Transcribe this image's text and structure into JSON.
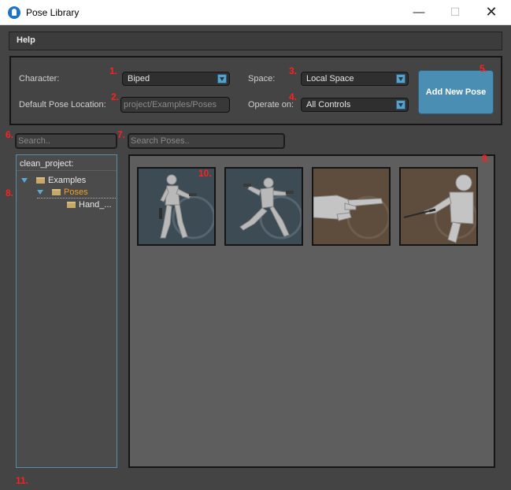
{
  "window": {
    "title": "Pose Library",
    "minimize": "—",
    "maximize": "☐",
    "close": "✕"
  },
  "menu": {
    "help": "Help"
  },
  "settings": {
    "character_label": "Character:",
    "character_value": "Biped",
    "pose_location_label": "Default Pose Location:",
    "pose_location_value": "project/Examples/Poses",
    "space_label": "Space:",
    "space_value": "Local Space",
    "operate_label": "Operate on:",
    "operate_value": "All Controls",
    "add_button": "Add New Pose"
  },
  "search": {
    "folder_placeholder": "Search..",
    "poses_placeholder": "Search Poses.."
  },
  "tree": {
    "root": "clean_project:",
    "items": [
      {
        "label": "Examples"
      },
      {
        "label": "Poses"
      },
      {
        "label": "Hand_..."
      }
    ]
  },
  "poses": [
    {
      "name": "pose-gun-stand",
      "tint": "blue"
    },
    {
      "name": "pose-gun-leap",
      "tint": "blue"
    },
    {
      "name": "pose-hand-point",
      "tint": "brown"
    },
    {
      "name": "pose-sword",
      "tint": "brown"
    }
  ],
  "markers": [
    "1.",
    "2.",
    "3.",
    "4.",
    "5.",
    "6.",
    "7.",
    "8.",
    "8.",
    "10.",
    "11."
  ],
  "colors": {
    "accent": "#4a8fb3",
    "selected_folder": "#f0a020",
    "marker": "#ff2020",
    "background": "#444444"
  }
}
